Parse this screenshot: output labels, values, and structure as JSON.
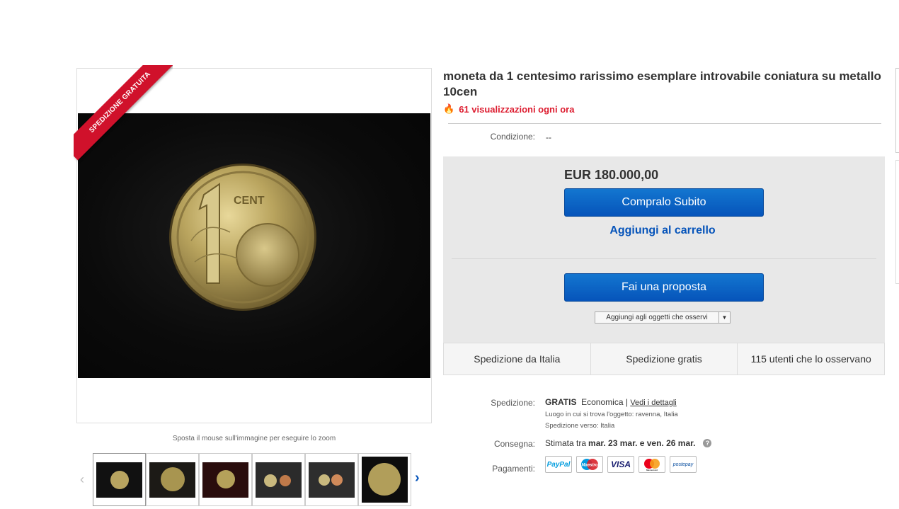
{
  "listing": {
    "title": "moneta da 1 centesimo rarissimo esemplare introvabile coniatura su metallo 10cen",
    "views": "61 visualizzazioni ogni ora",
    "condition_label": "Condizione:",
    "condition_value": "--"
  },
  "image": {
    "ribbon_text": "SPEDIZIONE GRATUITA",
    "zoom_hint": "Sposta il mouse sull'immagine per eseguire lo zoom",
    "thumbnail_count": 6
  },
  "buy": {
    "price": "EUR 180.000,00",
    "buy_now_label": "Compralo Subito",
    "add_to_cart_label": "Aggiungi al carrello",
    "offer_label": "Fai una proposta",
    "watch_label": "Aggiungi agli oggetti che osservi"
  },
  "infobar": {
    "from": "Spedizione da Italia",
    "free": "Spedizione gratis",
    "watchers": "115 utenti che lo osservano"
  },
  "shipping": {
    "label": "Spedizione:",
    "price": "GRATIS",
    "service": "Economica",
    "separator": "|",
    "details_link": "Vedi i dettagli",
    "location": "Luogo in cui si trova l'oggetto: ravenna, Italia",
    "ships_to": "Spedizione verso: Italia"
  },
  "delivery": {
    "label": "Consegna:",
    "prefix": "Stimata tra",
    "range": "mar. 23 mar. e ven. 26 mar.",
    "help_icon": "?"
  },
  "payments": {
    "label": "Pagamenti:",
    "methods": [
      "PayPal",
      "Maestro",
      "VISA",
      "Mastercard",
      "postepay"
    ]
  },
  "colors": {
    "brand_blue": "#0654ba",
    "ribbon_red": "#d0112b",
    "views_red": "#dd1e31"
  }
}
